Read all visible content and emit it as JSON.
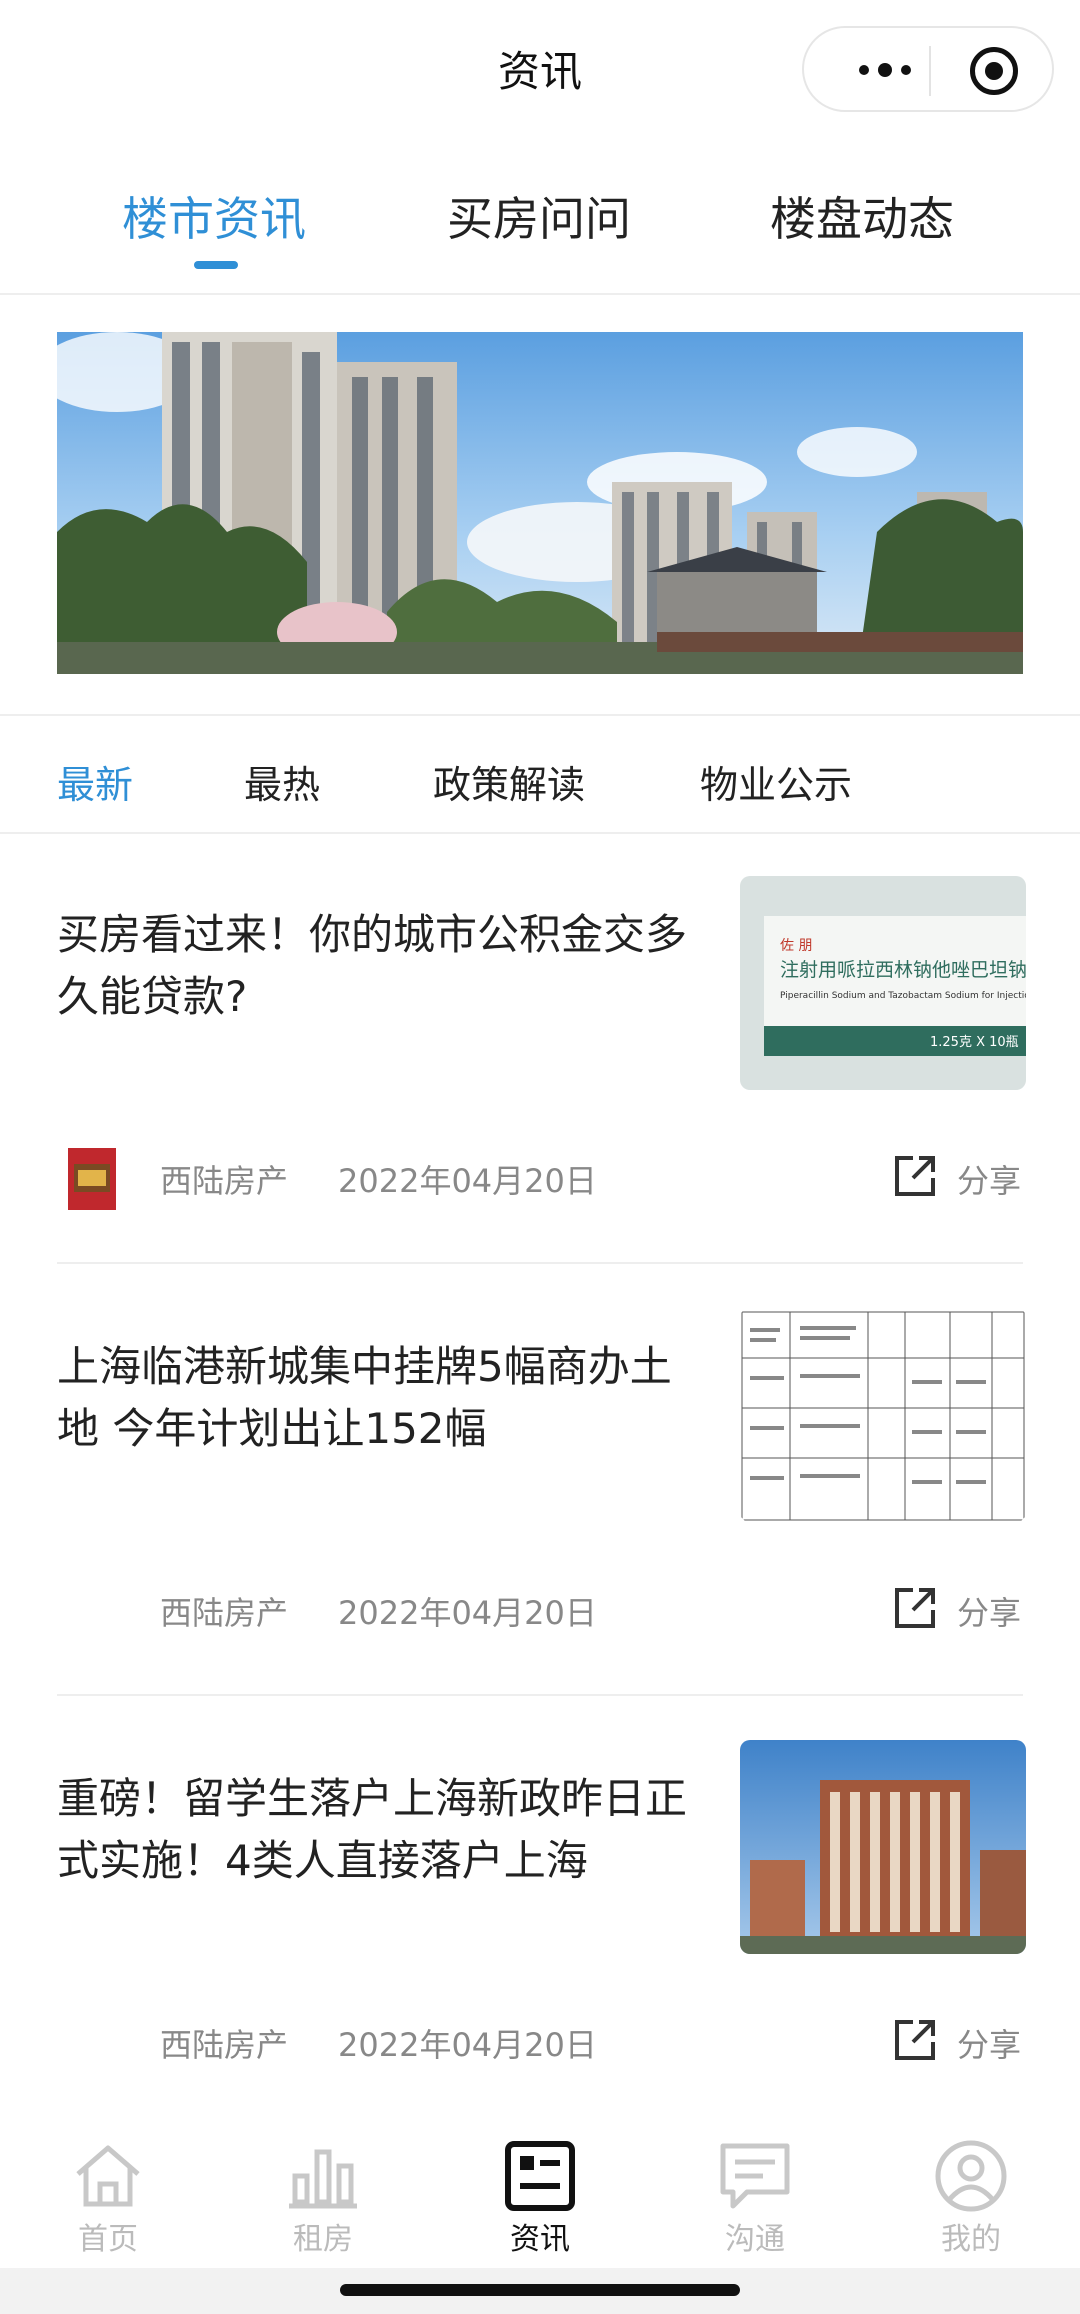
{
  "header": {
    "title": "资讯",
    "more_icon": "more-dots-icon",
    "close_icon": "target-close-icon"
  },
  "main_tabs": [
    {
      "label": "楼市资讯",
      "active": true
    },
    {
      "label": "买房问问",
      "active": false
    },
    {
      "label": "楼盘动态",
      "active": false
    }
  ],
  "sub_tabs": [
    {
      "label": "最新",
      "active": true
    },
    {
      "label": "最热",
      "active": false
    },
    {
      "label": "政策解读",
      "active": false
    },
    {
      "label": "物业公示",
      "active": false
    }
  ],
  "articles": [
    {
      "title": "买房看过来！你的城市公积金交多久能贷款?",
      "source": "西陆房产",
      "date": "2022年04月20日",
      "share_label": "分享",
      "thumb_text": {
        "brand": "佐 朋",
        "cn": "注射用哌拉西林钠他唑巴坦钠",
        "en": "Piperacillin Sodium and Tazobactam Sodium for Injection",
        "spec": "1.25克 X 10瓶"
      }
    },
    {
      "title": "上海临港新城集中挂牌5幅商办土地 今年计划出让152幅",
      "source": "西陆房产",
      "date": "2022年04月20日",
      "share_label": "分享"
    },
    {
      "title": "重磅！留学生落户上海新政昨日正式实施！4类人直接落户上海",
      "source": "西陆房产",
      "date": "2022年04月20日",
      "share_label": "分享"
    }
  ],
  "bottom_nav": [
    {
      "label": "首页",
      "icon": "home-icon",
      "active": false
    },
    {
      "label": "租房",
      "icon": "bar-chart-icon",
      "active": false
    },
    {
      "label": "资讯",
      "icon": "news-icon",
      "active": true
    },
    {
      "label": "沟通",
      "icon": "chat-icon",
      "active": false
    },
    {
      "label": "我的",
      "icon": "user-icon",
      "active": false
    }
  ],
  "colors": {
    "accent": "#2f8fd6",
    "text": "#222222",
    "muted": "#888888",
    "nav_inactive": "#bbbbbb"
  }
}
